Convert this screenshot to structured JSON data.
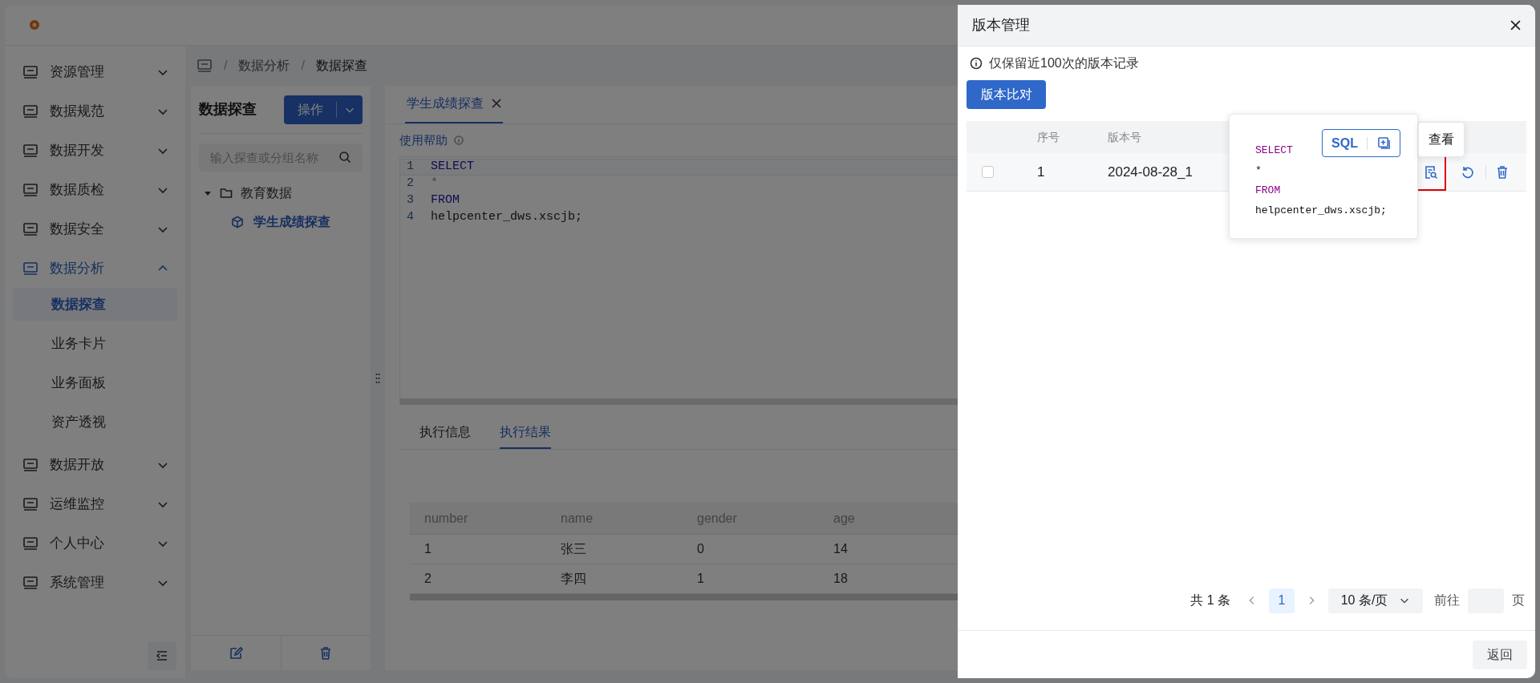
{
  "sidebar": {
    "items": [
      {
        "label": "资源管理",
        "expanded": false
      },
      {
        "label": "数据规范",
        "expanded": false
      },
      {
        "label": "数据开发",
        "expanded": false
      },
      {
        "label": "数据质检",
        "expanded": false
      },
      {
        "label": "数据安全",
        "expanded": false
      },
      {
        "label": "数据分析",
        "expanded": true,
        "children": [
          {
            "label": "数据探查",
            "selected": true
          },
          {
            "label": "业务卡片",
            "selected": false
          },
          {
            "label": "业务面板",
            "selected": false
          },
          {
            "label": "资产透视",
            "selected": false
          }
        ]
      },
      {
        "label": "数据开放",
        "expanded": false
      },
      {
        "label": "运维监控",
        "expanded": false
      },
      {
        "label": "个人中心",
        "expanded": false
      },
      {
        "label": "系统管理",
        "expanded": false
      }
    ]
  },
  "breadcrumb": {
    "separator": "/",
    "items": [
      "数据分析",
      "数据探查"
    ]
  },
  "explorer": {
    "title": "数据探查",
    "action_button": "操作",
    "search": {
      "placeholder": "输入探查或分组名称"
    },
    "tree": [
      {
        "label": "教育数据",
        "expanded": true,
        "children": [
          {
            "label": "学生成绩探查",
            "selected": true
          }
        ]
      }
    ]
  },
  "editor": {
    "tabs": [
      {
        "label": "学生成绩探查",
        "selected": true
      }
    ],
    "help": "使用帮助",
    "lines": [
      {
        "number": "1",
        "text": "SELECT",
        "kind": "keyword"
      },
      {
        "number": "2",
        "text": "*",
        "kind": "operator"
      },
      {
        "number": "3",
        "text": "FROM",
        "kind": "keyword"
      },
      {
        "number": "4",
        "text": "helpcenter_dws.xscjb;",
        "kind": "plain"
      }
    ]
  },
  "results": {
    "tabs": [
      {
        "label": "执行信息",
        "selected": false
      },
      {
        "label": "执行结果",
        "selected": true
      }
    ],
    "columns": [
      "number",
      "name",
      "gender",
      "age"
    ],
    "rows": [
      [
        "1",
        "张三",
        "0",
        "14"
      ],
      [
        "2",
        "李四",
        "1",
        "18"
      ]
    ]
  },
  "drawer": {
    "title": "版本管理",
    "notice": "仅保留近100次的版本记录",
    "compare_button": "版本比对",
    "columns": [
      "序号",
      "版本号"
    ],
    "rows": [
      {
        "checked": false,
        "index": "1",
        "version": "2024-08-28_1"
      }
    ],
    "popover": {
      "badge": "SQL",
      "lines": [
        {
          "text": "SELECT",
          "kind": "keyword"
        },
        {
          "text": "*",
          "kind": "plain"
        },
        {
          "text": "FROM",
          "kind": "keyword"
        },
        {
          "text": "helpcenter_dws.xscjb;",
          "kind": "plain"
        }
      ]
    },
    "tooltip": "查看",
    "pagination": {
      "total": "共 1 条",
      "pages": [
        {
          "label": "1",
          "selected": true
        }
      ],
      "page_size": "10 条/页",
      "goto": "前往",
      "goto_suffix": "页"
    },
    "back_button": "返回"
  }
}
